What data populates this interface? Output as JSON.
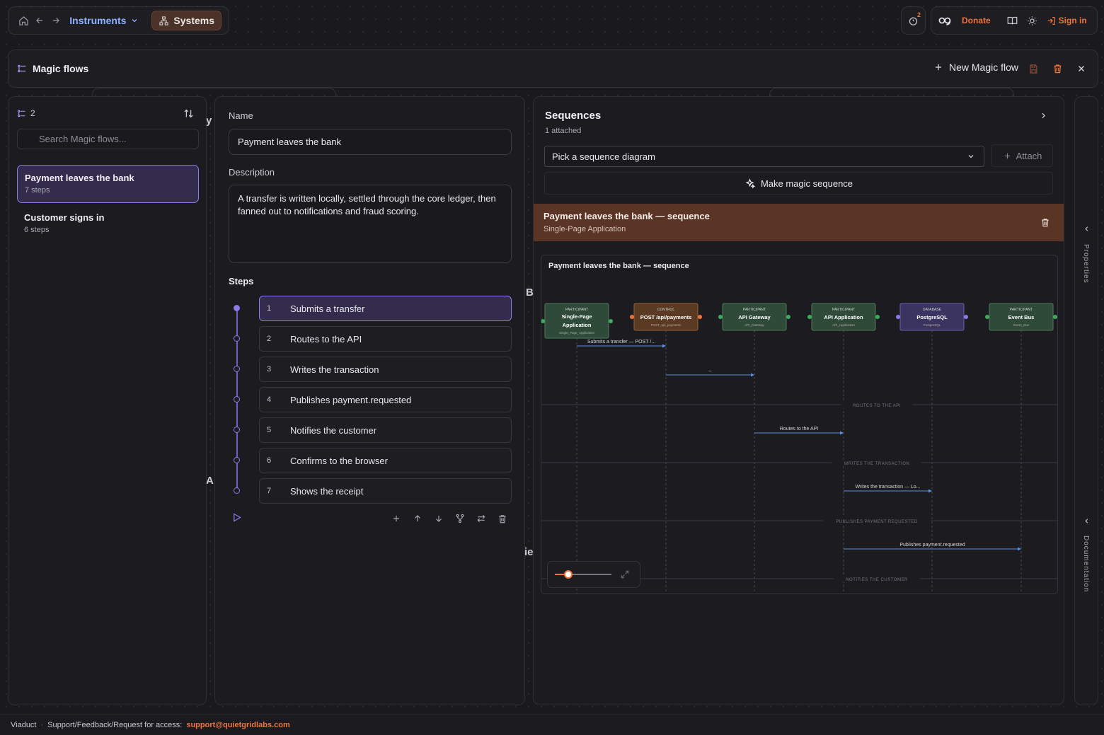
{
  "nav": {
    "instruments_label": "Instruments",
    "systems_label": "Systems",
    "notification_count": "2",
    "donate_label": "Donate",
    "signin_label": "Sign in"
  },
  "magic": {
    "title": "Magic flows",
    "new_flow_label": "New Magic flow"
  },
  "flow_list": {
    "count": "2",
    "search_placeholder": "Search Magic flows...",
    "items": [
      {
        "name": "Payment leaves the bank",
        "sub": "7 steps"
      },
      {
        "name": "Customer signs in",
        "sub": "6 steps"
      }
    ]
  },
  "editor": {
    "name_label": "Name",
    "name_value": "Payment leaves the bank",
    "description_label": "Description",
    "description_value": "A transfer is written locally, settled through the core ledger, then fanned out to notifications and fraud scoring.",
    "steps_label": "Steps",
    "steps": [
      {
        "n": "1",
        "label": "Submits a transfer"
      },
      {
        "n": "2",
        "label": "Routes to the API"
      },
      {
        "n": "3",
        "label": "Writes the transaction"
      },
      {
        "n": "4",
        "label": "Publishes payment.requested"
      },
      {
        "n": "5",
        "label": "Notifies the customer"
      },
      {
        "n": "6",
        "label": "Confirms to the browser"
      },
      {
        "n": "7",
        "label": "Shows the receipt"
      }
    ]
  },
  "sequences": {
    "title": "Sequences",
    "attached": "1 attached",
    "select_placeholder": "Pick a sequence diagram",
    "attach_label": "Attach",
    "make_magic_label": "Make magic sequence",
    "attached_item": {
      "title": "Payment leaves the bank — sequence",
      "sub": "Single-Page Application"
    },
    "diagram_title": "Payment leaves the bank — sequence",
    "participants": [
      {
        "kind": "PARTICIPANT",
        "name": "Single-Page Application",
        "id": "Single_Page_Application",
        "color": "#2f4a39"
      },
      {
        "kind": "CONTROL",
        "name": "POST /api/payments",
        "id": "POST_api_payments",
        "color": "#5a3a22"
      },
      {
        "kind": "PARTICIPANT",
        "name": "API Gateway",
        "id": "API_Gateway",
        "color": "#2f4a39"
      },
      {
        "kind": "PARTICIPANT",
        "name": "API Application",
        "id": "API_Application",
        "color": "#2f4a39"
      },
      {
        "kind": "DATABASE",
        "name": "PostgreSQL",
        "id": "PostgreSQL",
        "color": "#3b3460"
      },
      {
        "kind": "PARTICIPANT",
        "name": "Event Bus",
        "id": "Event_Bus",
        "color": "#2f4a39"
      }
    ],
    "messages": [
      {
        "label": "Submits a transfer — POST /..."
      },
      {
        "label": "–"
      },
      {
        "label": "Routes to the API"
      },
      {
        "label": "Writes the transaction — Lo..."
      },
      {
        "label": "Publishes payment.requested"
      }
    ],
    "section_labels": [
      "ROUTES TO THE API",
      "WRITES THE TRANSACTION",
      "PUBLISHES PAYMENT.REQUESTED",
      "NOTIFIES THE CUSTOMER"
    ]
  },
  "side": {
    "properties_label": "Properties",
    "documentation_label": "Documentation"
  },
  "footer": {
    "app": "Viaduct",
    "separator": "·",
    "support_text": "Support/Feedback/Request for access:",
    "email": "support@quietgridlabs.com"
  },
  "colors": {
    "accent_purple": "#8d7ae6",
    "accent_orange": "#f0743a",
    "link_blue": "#8cb3ff",
    "arrow_blue": "#5b8fe0"
  },
  "icons": [
    "home-icon",
    "arrow-left-icon",
    "arrow-right-icon",
    "chevron-down-icon",
    "systems-icon",
    "shield-icon",
    "logo-icon",
    "book-icon",
    "sun-icon",
    "sign-in-icon",
    "flows-icon",
    "plus-icon",
    "save-icon",
    "trash-icon",
    "close-icon",
    "sort-icon",
    "search-icon",
    "play-icon",
    "arrow-up-icon",
    "arrow-down-icon",
    "branch-icon",
    "swap-icon",
    "sparkle-icon",
    "chevron-right-icon",
    "chevron-left-icon",
    "expand-icon"
  ]
}
